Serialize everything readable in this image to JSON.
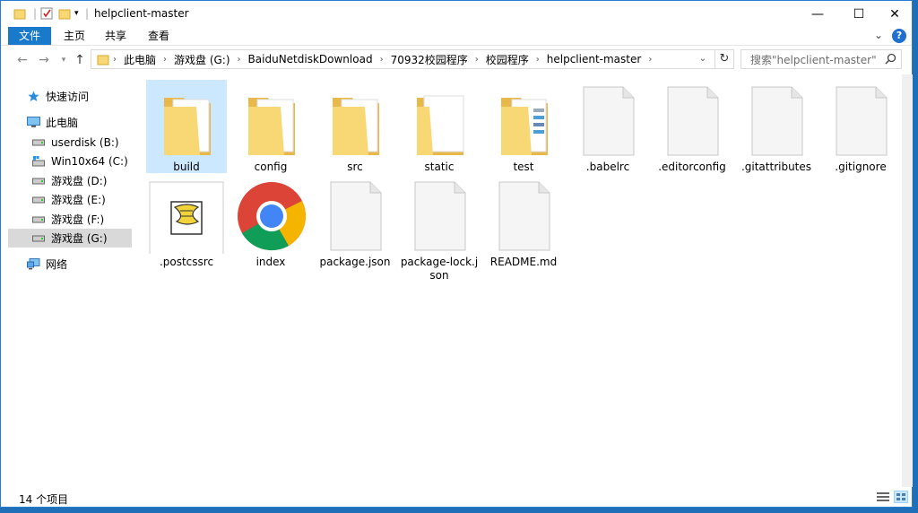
{
  "window": {
    "title": "helpclient-master",
    "controls": [
      "—",
      "☐",
      "✕"
    ]
  },
  "ribbon": {
    "tabs": [
      "文件",
      "主页",
      "共享",
      "查看"
    ],
    "help": "?"
  },
  "nav": {
    "breadcrumbs": [
      "此电脑",
      "游戏盘 (G:)",
      "BaiduNetdiskDownload",
      "70932校园程序",
      "校园程序",
      "helpclient-master"
    ],
    "search_placeholder": "搜索\"helpclient-master\""
  },
  "sidebar": {
    "items": [
      {
        "label": "快速访问",
        "icon": "star-icon"
      },
      {
        "label": "此电脑",
        "icon": "computer-icon"
      },
      {
        "label": "userdisk (B:)",
        "icon": "drive-icon"
      },
      {
        "label": "Win10x64 (C:)",
        "icon": "windows-drive-icon"
      },
      {
        "label": "游戏盘 (D:)",
        "icon": "drive-icon"
      },
      {
        "label": "游戏盘 (E:)",
        "icon": "drive-icon"
      },
      {
        "label": "游戏盘 (F:)",
        "icon": "drive-icon"
      },
      {
        "label": "游戏盘 (G:)",
        "icon": "drive-icon"
      },
      {
        "label": "网络",
        "icon": "network-icon"
      }
    ]
  },
  "files": [
    {
      "name": "build",
      "type": "folder"
    },
    {
      "name": "config",
      "type": "folder"
    },
    {
      "name": "src",
      "type": "folder"
    },
    {
      "name": "static",
      "type": "folder"
    },
    {
      "name": "test",
      "type": "folder"
    },
    {
      "name": ".babelrc",
      "type": "file"
    },
    {
      "name": ".editorconfig",
      "type": "file"
    },
    {
      "name": ".gitattributes",
      "type": "file"
    },
    {
      "name": ".gitignore",
      "type": "file"
    },
    {
      "name": ".postcssrc",
      "type": "script"
    },
    {
      "name": "index",
      "type": "chrome"
    },
    {
      "name": "package.json",
      "type": "file"
    },
    {
      "name": "package-lock.json",
      "type": "file"
    },
    {
      "name": "README.md",
      "type": "file"
    }
  ],
  "status": {
    "count_text": "14 个项目"
  },
  "colors": {
    "accent": "#1979ca",
    "selected": "#cce8ff",
    "folder": "#f8d775"
  }
}
